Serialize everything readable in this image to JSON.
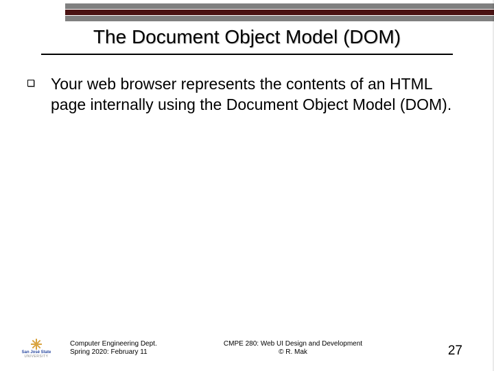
{
  "title": "The Document Object Model (DOM)",
  "bullet_text": "Your web browser represents the contents of an HTML page internally using the Document Object Model (DOM).",
  "footer": {
    "left_line1": "Computer Engineering Dept.",
    "left_line2": "Spring 2020: February 11",
    "center_line1": "CMPE 280: Web UI Design and Development",
    "center_line2": "© R. Mak",
    "page_number": "27"
  },
  "logo": {
    "label": "San José State",
    "sub": "UNIVERSITY"
  }
}
